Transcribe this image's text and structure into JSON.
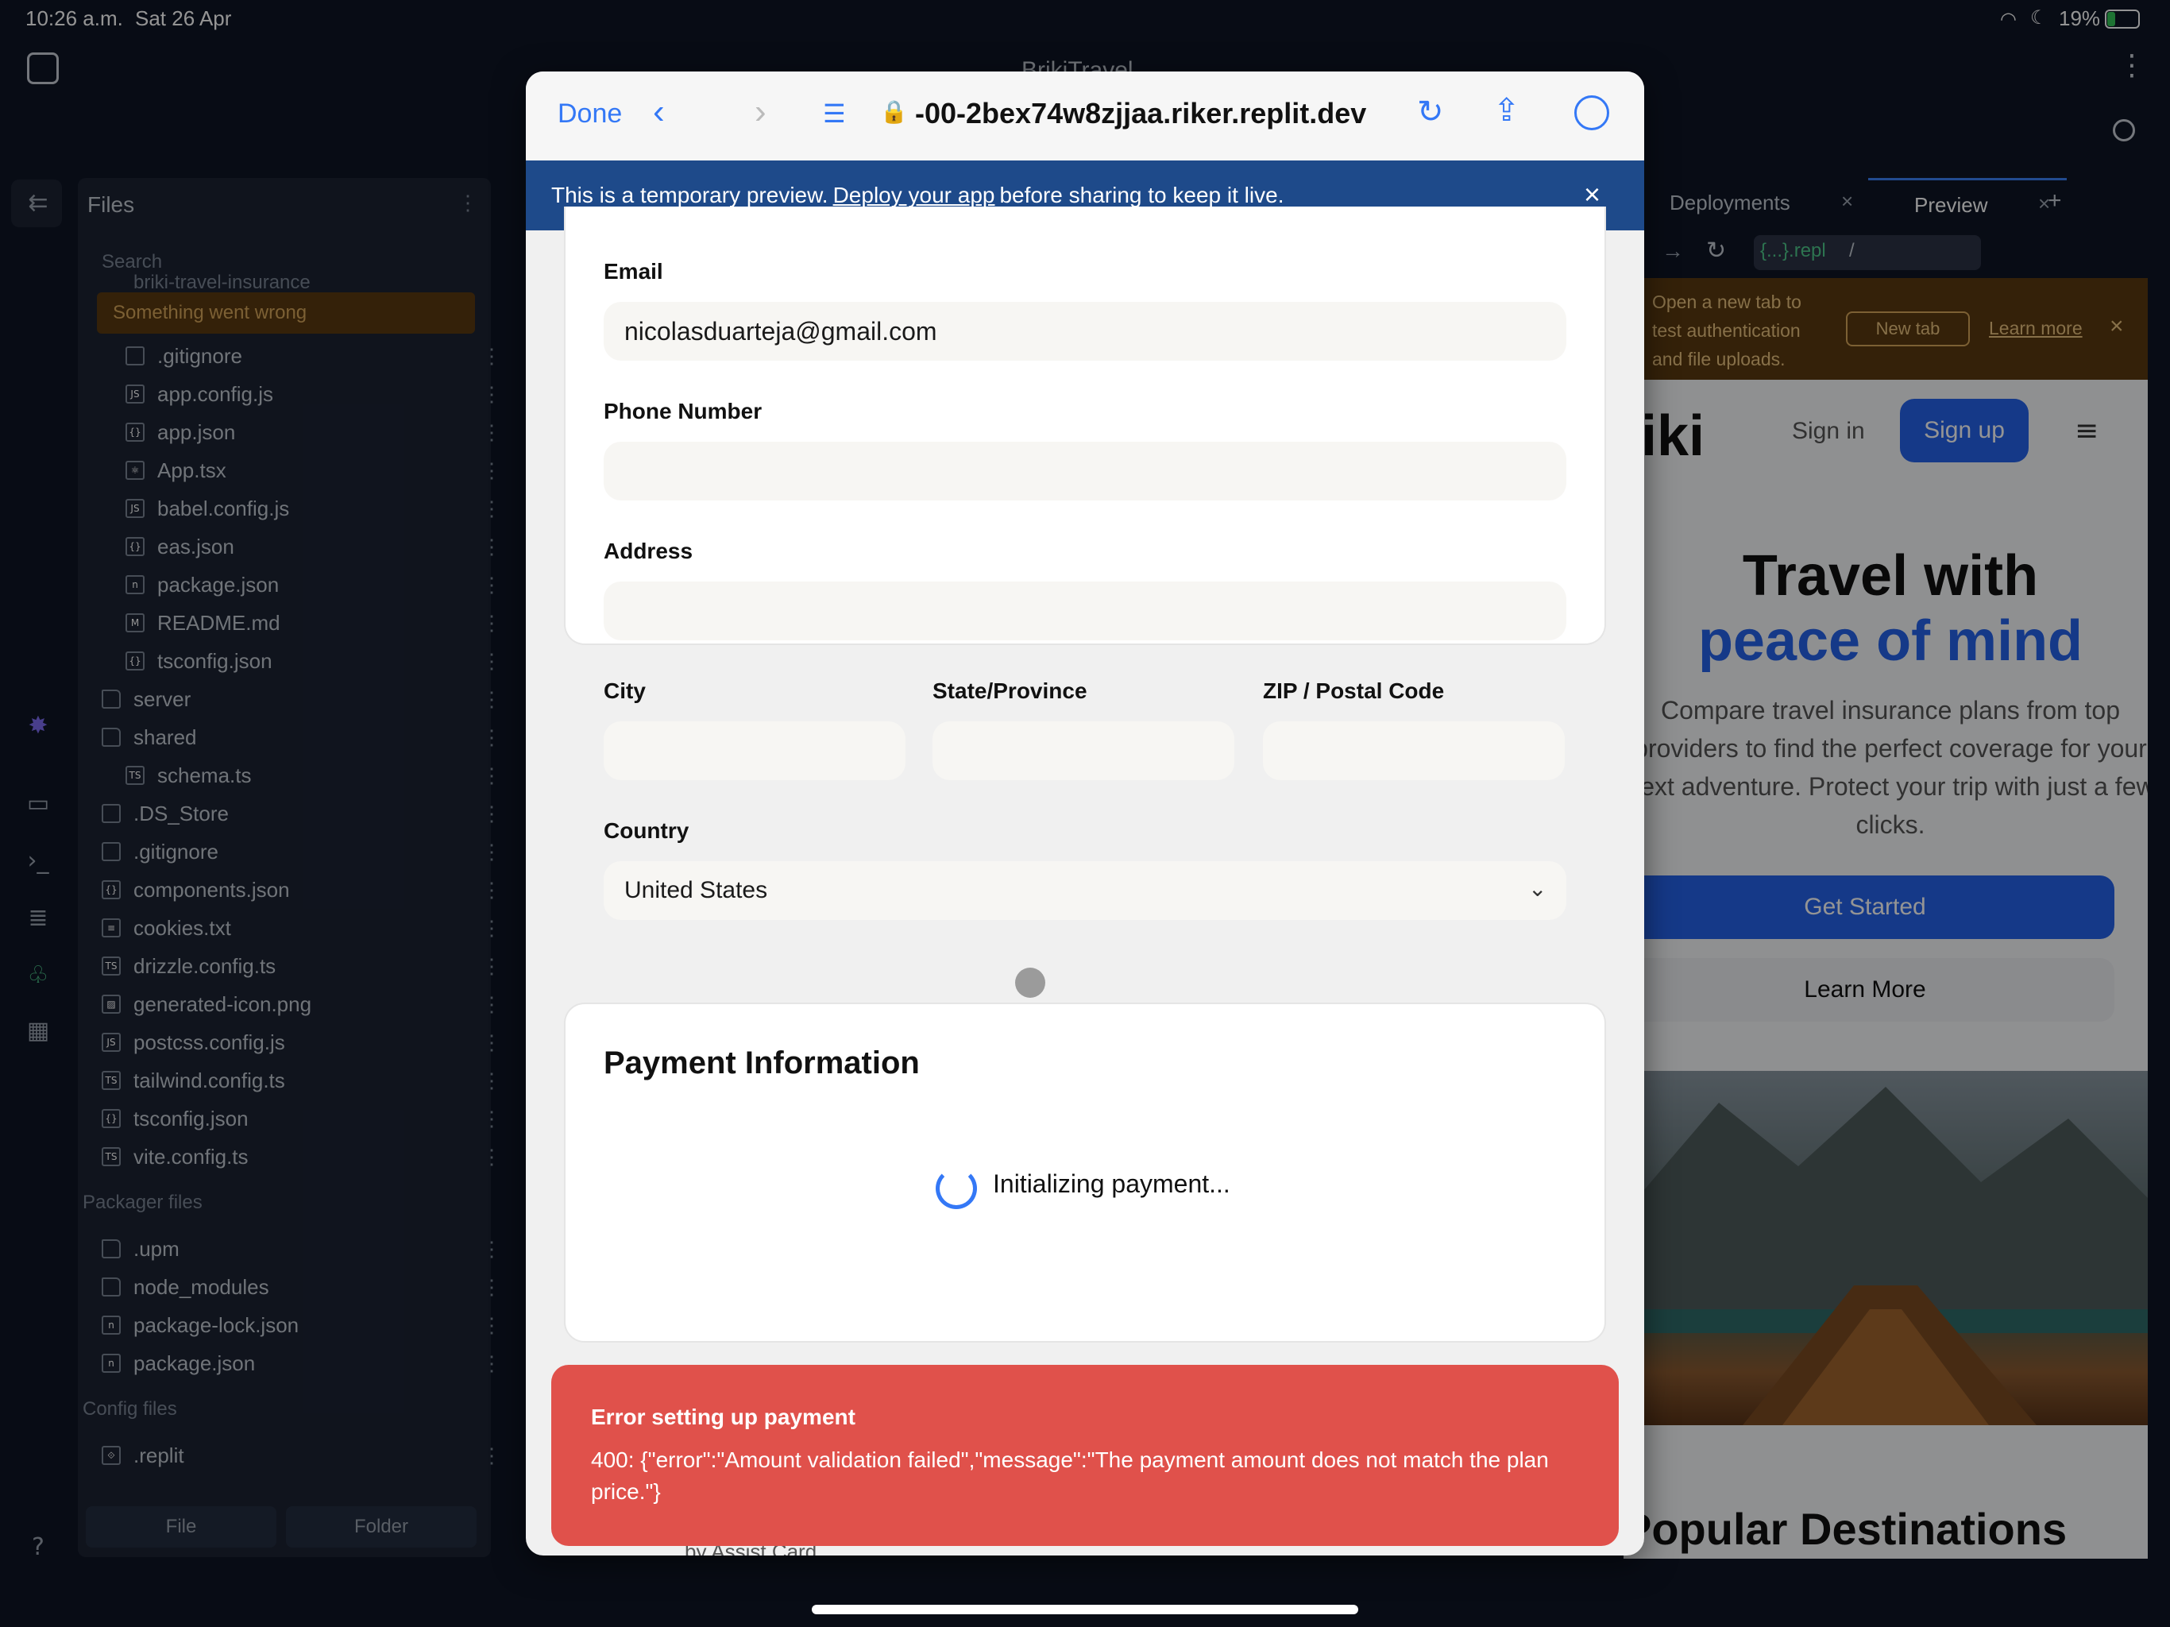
{
  "status_bar": {
    "time": "10:26 a.m.",
    "date": "Sat 26 Apr",
    "battery": "19%"
  },
  "app": {
    "title": "BrikiTravel"
  },
  "sidebar": {
    "header": "Files",
    "search_placeholder": "Search",
    "error_text": "Something went wrong",
    "truncated_item": "briki-travel-insurance",
    "files": [
      {
        "name": ".gitignore",
        "icon": "file-icon"
      },
      {
        "name": "app.config.js",
        "icon": "js-icon"
      },
      {
        "name": "app.json",
        "icon": "json-icon"
      },
      {
        "name": "App.tsx",
        "icon": "react-icon"
      },
      {
        "name": "babel.config.js",
        "icon": "js-icon"
      },
      {
        "name": "eas.json",
        "icon": "json-icon"
      },
      {
        "name": "package.json",
        "icon": "npm-icon"
      },
      {
        "name": "README.md",
        "icon": "markdown-icon"
      },
      {
        "name": "tsconfig.json",
        "icon": "json-icon"
      }
    ],
    "root_items": [
      {
        "name": "server",
        "icon": "folder-icon"
      },
      {
        "name": "shared",
        "icon": "folder-icon"
      },
      {
        "name": "schema.ts",
        "icon": "ts-icon",
        "indent": true
      },
      {
        "name": ".DS_Store",
        "icon": "file-icon"
      },
      {
        "name": ".gitignore",
        "icon": "file-icon"
      },
      {
        "name": "components.json",
        "icon": "json-icon"
      },
      {
        "name": "cookies.txt",
        "icon": "text-icon"
      },
      {
        "name": "drizzle.config.ts",
        "icon": "ts-icon"
      },
      {
        "name": "generated-icon.png",
        "icon": "image-icon"
      },
      {
        "name": "postcss.config.js",
        "icon": "js-icon"
      },
      {
        "name": "tailwind.config.ts",
        "icon": "ts-icon"
      },
      {
        "name": "tsconfig.json",
        "icon": "json-icon"
      },
      {
        "name": "vite.config.ts",
        "icon": "ts-icon"
      }
    ],
    "packager_header": "Packager files",
    "packager_items": [
      {
        "name": ".upm",
        "icon": "folder-icon"
      },
      {
        "name": "node_modules",
        "icon": "folder-icon"
      },
      {
        "name": "package-lock.json",
        "icon": "npm-icon"
      },
      {
        "name": "package.json",
        "icon": "npm-icon"
      }
    ],
    "config_header": "Config files",
    "config_items": [
      {
        "name": ".replit",
        "icon": "replit-icon"
      }
    ],
    "footer_file": "File",
    "footer_folder": "Folder"
  },
  "browser": {
    "done": "Done",
    "url": "-00-2bex74w8zjjaa.riker.replit.dev",
    "banner_pre": "This is a temporary preview.",
    "banner_link": "Deploy your app",
    "banner_post": "before sharing to keep it live."
  },
  "form": {
    "email_label": "Email",
    "email_value": "nicolasduarteja@gmail.com",
    "phone_label": "Phone Number",
    "address_label": "Address",
    "city_label": "City",
    "state_label": "State/Province",
    "zip_label": "ZIP / Postal Code",
    "country_label": "Country",
    "country_value": "United States"
  },
  "payment": {
    "title": "Payment Information",
    "loading": "Initializing payment..."
  },
  "error": {
    "title": "Error setting up payment",
    "message": "400: {\"error\":\"Amount validation failed\",\"message\":\"The payment amount does not match the plan price.\"}",
    "behind_text": "by Assist Card"
  },
  "tabs": {
    "deployments": "Deployments",
    "preview": "Preview"
  },
  "preview_url": {
    "host": "{...}.repl",
    "path": "/"
  },
  "notice": {
    "text": "Open a new tab to test authentication and file uploads.",
    "new_tab": "New tab",
    "learn_more": "Learn more"
  },
  "site": {
    "logo": "briki",
    "sign_in": "Sign in",
    "sign_up": "Sign up",
    "hero_line1": "Travel with",
    "hero_line2": "peace of mind",
    "description": "Compare travel insurance plans from top providers to find the perfect coverage for your next adventure. Protect your trip with just a few clicks.",
    "get_started": "Get Started",
    "learn_more": "Learn More",
    "popular": "Popular Destinations"
  }
}
